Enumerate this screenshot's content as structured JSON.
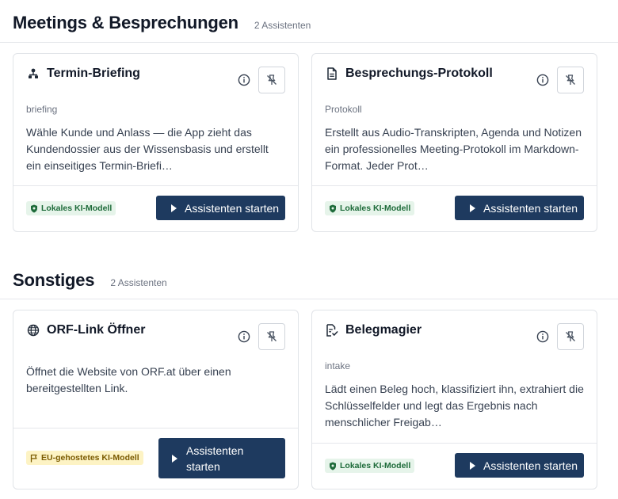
{
  "sections": [
    {
      "title": "Meetings & Besprechungen",
      "count": "2 Assistenten",
      "cards": [
        {
          "icon": "person-hierarchy-icon",
          "title": "Termin-Briefing",
          "slug": "briefing",
          "description": "Wähle Kunde und Anlass — die App zieht das Kundendossier aus der Wissensbasis und erstellt ein einseitiges Termin-Briefi…",
          "badge": "Lokales KI-Modell",
          "start_label": "Assistenten starten"
        },
        {
          "icon": "document-icon",
          "title": "Besprechungs-Protokoll",
          "slug": "Protokoll",
          "description": "Erstellt aus Audio-Transkripten, Agenda und Notizen ein professionelles Meeting-Protokoll im Markdown-Format. Jeder Prot…",
          "badge": "Lokales KI-Modell",
          "start_label": "Assistenten starten"
        }
      ]
    },
    {
      "title": "Sonstiges",
      "count": "2 Assistenten",
      "cards": [
        {
          "icon": "globe-icon",
          "title": "ORF-Link Öffner",
          "description": "Öffnet die Website von ORF.at über einen bereitgestellten Link.",
          "badge": "EU-gehostetes KI-Modell",
          "start_label_line1": "Assistenten",
          "start_label_line2": "starten"
        },
        {
          "icon": "receipt-icon",
          "title": "Belegmagier",
          "slug": "intake",
          "description": "Lädt einen Beleg hoch, klassifiziert ihn, extrahiert die Schlüsselfelder und legt das Ergebnis nach menschlicher Freigab…",
          "badge": "Lokales KI-Modell",
          "start_label": "Assistenten starten"
        }
      ]
    }
  ],
  "colors": {
    "primary_button": "#1e3a5f",
    "badge_local_bg": "#e6f4ea",
    "badge_local_text": "#1e6b3a",
    "badge_eu_bg": "#fdf3c4",
    "badge_eu_text": "#7a5a00"
  }
}
